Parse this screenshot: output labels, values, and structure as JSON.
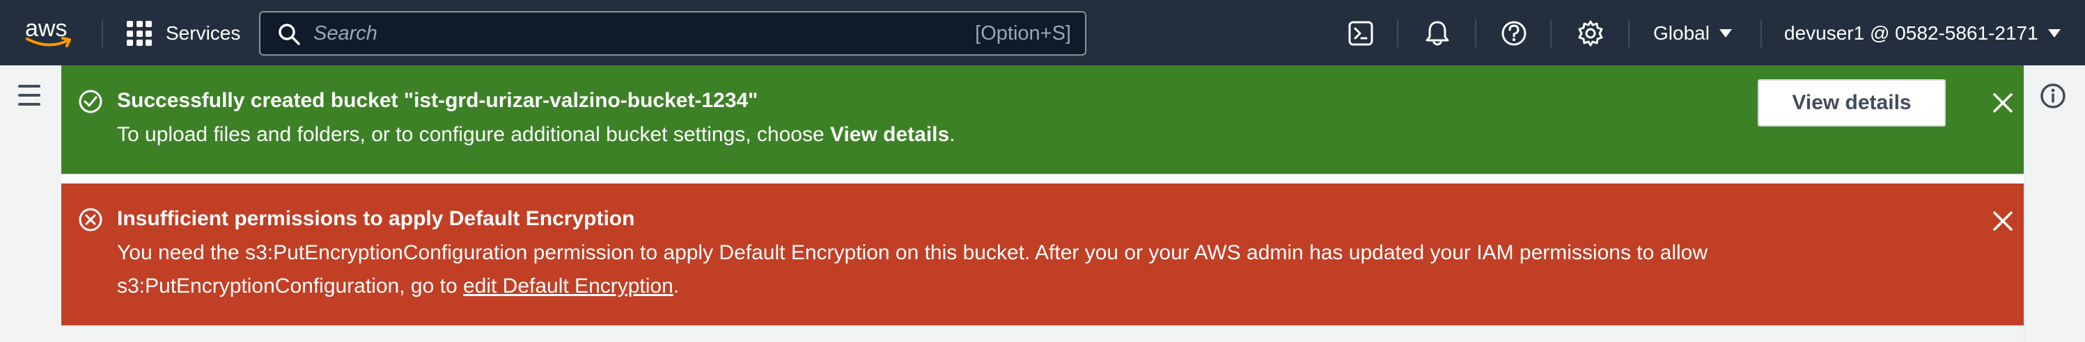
{
  "topnav": {
    "logo_text": "aws",
    "services_label": "Services",
    "search": {
      "placeholder": "Search",
      "value": "",
      "shortcut": "[Option+S]"
    },
    "region_label": "Global",
    "account_label": "devuser1 @ 0582-5861-2171"
  },
  "icons": {
    "cloudshell": "cloudshell-icon",
    "notifications": "bell-icon",
    "help": "help-icon",
    "settings": "gear-icon",
    "menu": "hamburger-menu-icon",
    "info": "info-icon"
  },
  "flash": {
    "success": {
      "title": "Successfully created bucket \"ist-grd-urizar-valzino-bucket-1234\"",
      "body_prefix": "To upload files and folders, or to configure additional bucket settings, choose ",
      "body_bold": "View details",
      "body_suffix": ".",
      "action_label": "View details",
      "color": "#3d8127"
    },
    "error": {
      "title": "Insufficient permissions to apply Default Encryption",
      "body_line1": "You need the s3:PutEncryptionConfiguration permission to apply Default Encryption on this bucket. After you or your AWS admin has updated your IAM permissions to allow",
      "body_line2_prefix": "s3:PutEncryptionConfiguration, go to ",
      "body_link": "edit Default Encryption",
      "body_line2_suffix": ".",
      "color": "#c13f25"
    }
  },
  "colors": {
    "nav_background": "#232f3e",
    "success": "#3d8127",
    "error": "#c13f25",
    "page_background": "#f2f3f3"
  }
}
